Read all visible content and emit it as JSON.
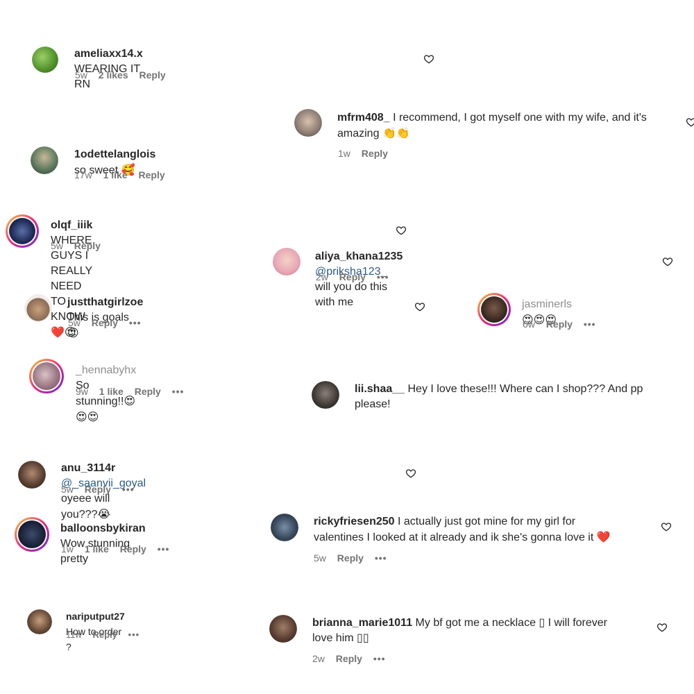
{
  "comments": [
    {
      "user": "ameliaxx14.x",
      "text": "WEARING IT RN",
      "time": "5w",
      "likes": "2 likes",
      "reply": "Reply"
    },
    {
      "user": "mfrm408_",
      "text": "I recommend, I got myself one with my wife, and it's",
      "text2": "amazing",
      "emoji": "👏👏",
      "time": "1w",
      "reply": "Reply"
    },
    {
      "user": "1odettelanglois",
      "text": "so sweet",
      "emoji": "🥰",
      "time": "17w",
      "likes": "1 like",
      "reply": "Reply"
    },
    {
      "user": "olqf_iiik",
      "text": "WHERE GUYS I REALLY NEED TO KNOW",
      "emoji": "❤️😍",
      "time": "5w",
      "reply": "Reply"
    },
    {
      "user": "aliya_khana1235",
      "mention": "@priksha123_",
      "text": "will you do this with me",
      "time": "2w",
      "reply": "Reply",
      "more": "•••"
    },
    {
      "user": "justthatgirlzoe",
      "text": "This is goals",
      "emoji": "😍",
      "time": "5w",
      "reply": "Reply",
      "more": "•••"
    },
    {
      "user": "jasminerls",
      "emoji": "😍😍😍",
      "time": "6w",
      "reply": "Reply",
      "more": "•••"
    },
    {
      "user": "_hennabyhx",
      "text": "So stunning!!",
      "emoji": "😍😍😍",
      "time": "9w",
      "likes": "1 like",
      "reply": "Reply",
      "more": "•••"
    },
    {
      "user": "lii.shaa__",
      "text": "Hey I love these!!! Where can I shop??? And pp",
      "text2": "please!"
    },
    {
      "user": "anu_3114r",
      "mention": "@_saanvii_goyal",
      "text": "oyeee will you???",
      "emoji": "😭",
      "time": "5w",
      "reply": "Reply",
      "more": "•••"
    },
    {
      "user": "balloonsbykiran",
      "text": "Wow stunning pretty",
      "time": "1w",
      "likes": "1 like",
      "reply": "Reply",
      "more": "•••"
    },
    {
      "user": "rickyfriesen250",
      "text": "I actually just got mine for my girl for",
      "text2": "valentines I looked at it already and ik she's gonna love it",
      "emoji": "❤️",
      "time": "5w",
      "reply": "Reply",
      "more": "•••"
    },
    {
      "user": "nariputput27",
      "text": "How to order ?",
      "time": "11w",
      "reply": "Reply",
      "more": "•••"
    },
    {
      "user": "brianna_marie1011",
      "text": "My bf got me a necklace ▯ I will forever",
      "text2": "love him ▯▯",
      "time": "2w",
      "reply": "Reply",
      "more": "•••"
    }
  ],
  "icons": {
    "like": "heart-outline-icon",
    "more": "more-options-icon"
  },
  "colors": {
    "text": "#262626",
    "meta": "#737373",
    "mention": "#2b5a86",
    "ring_start": "#f9ce34",
    "ring_mid": "#ee2a7b",
    "ring_end": "#6228d7"
  }
}
